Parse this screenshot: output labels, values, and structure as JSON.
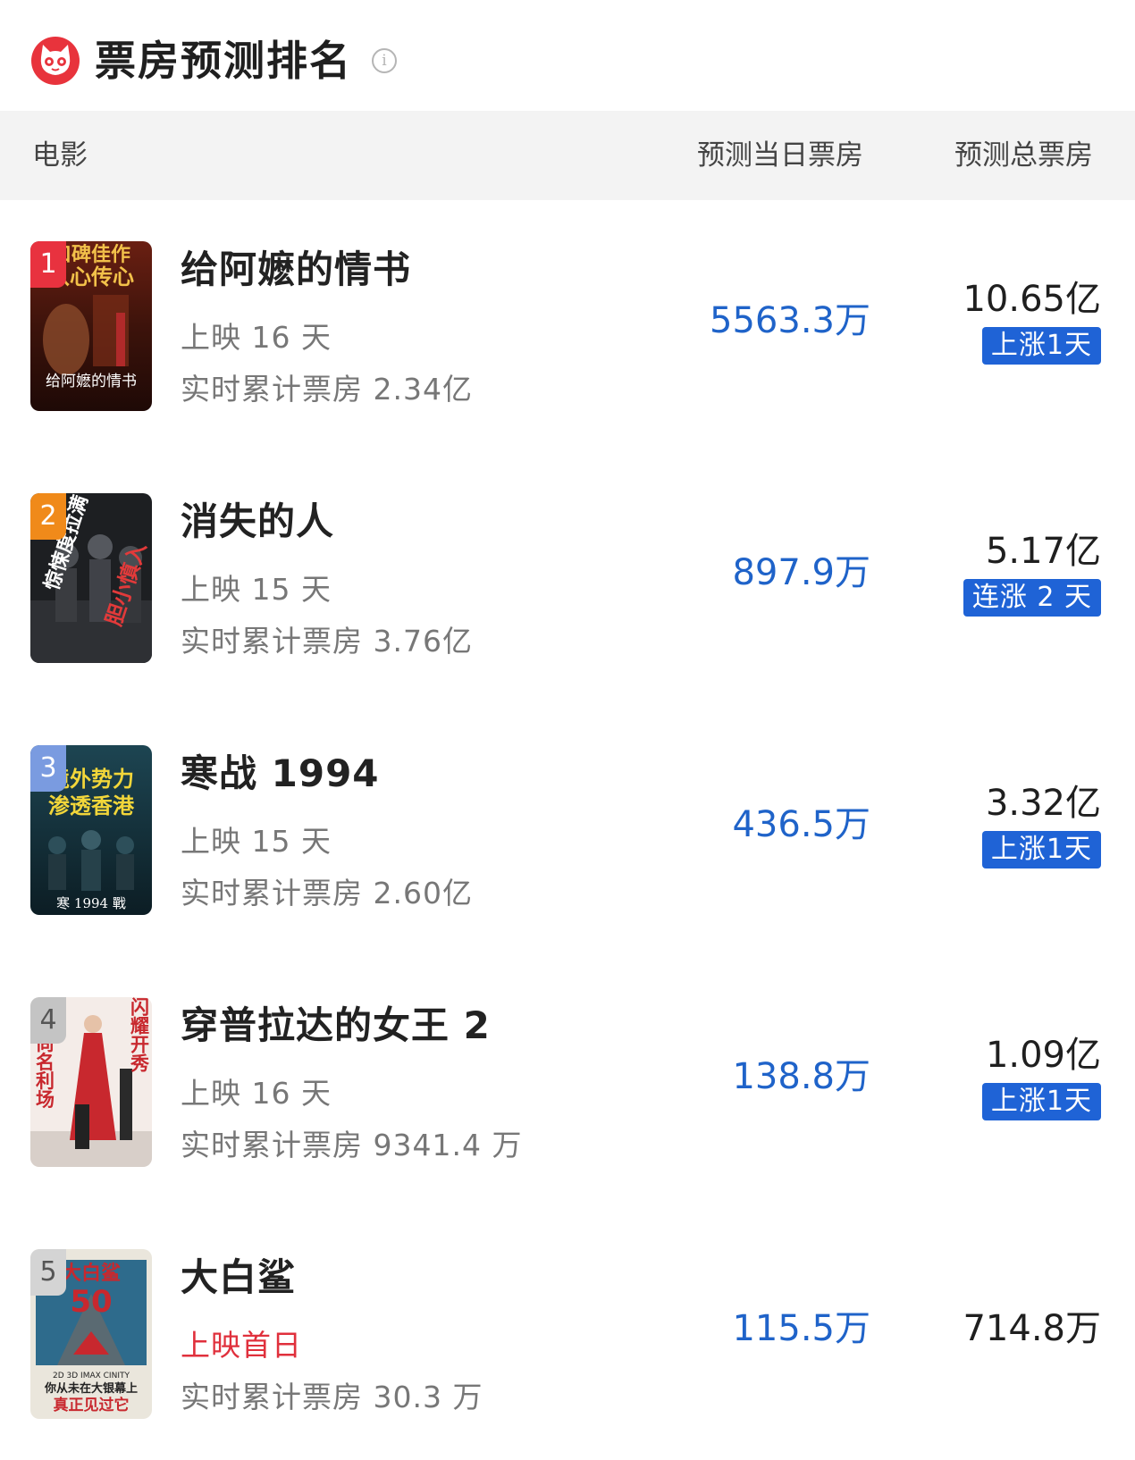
{
  "header": {
    "title": "票房预测排名",
    "info_icon": "i"
  },
  "columns": {
    "movie": "电影",
    "day": "预测当日票房",
    "total": "预测总票房"
  },
  "colors": {
    "accent_blue": "#1f63c9",
    "badge_blue": "#1f63d6",
    "red": "#e0303c",
    "brand_red": "#e8333c"
  },
  "movies": [
    {
      "rank": "1",
      "name": "给阿嬷的情书",
      "days": "上映 16 天",
      "cumulative": "实时累计票房 2.34亿",
      "day_box": "5563.3万",
      "total_box": "10.65亿",
      "badge": "上涨1天",
      "poster_text_a": "口碑佳作",
      "poster_text_b": "从心传心",
      "poster_title": "给阿嬷的情书"
    },
    {
      "rank": "2",
      "name": "消失的人",
      "days": "上映 15 天",
      "cumulative": "实时累计票房 3.76亿",
      "day_box": "897.9万",
      "total_box": "5.17亿",
      "badge": "连涨 2 天",
      "poster_text_a": "惊悚度拉满",
      "poster_text_b": "胆小慎入"
    },
    {
      "rank": "3",
      "name": "寒战 1994",
      "days": "上映 15 天",
      "cumulative": "实时累计票房 2.60亿",
      "day_box": "436.5万",
      "total_box": "3.32亿",
      "badge": "上涨1天",
      "poster_text_a": "境外势力",
      "poster_text_b": "渗透香港",
      "poster_title": "寒 1994 戰"
    },
    {
      "rank": "4",
      "name": "穿普拉达的女王 2",
      "days": "上映 16 天",
      "cumulative": "实时累计票房 9341.4 万",
      "day_box": "138.8万",
      "total_box": "1.09亿",
      "badge": "上涨1天",
      "poster_text_a": "时尚名利场",
      "poster_text_b": "闪耀开秀"
    },
    {
      "rank": "5",
      "name": "大白鲨",
      "days": "上映首日",
      "cumulative": "实时累计票房 30.3 万",
      "day_box": "115.5万",
      "total_box": "714.8万",
      "badge": "",
      "poster_text_a": "大白鲨",
      "poster_text_b": "50",
      "poster_text_c": "2D 3D IMAX CINITY",
      "poster_text_d": "你从未在大银幕上",
      "poster_text_e": "真正见过它"
    }
  ]
}
